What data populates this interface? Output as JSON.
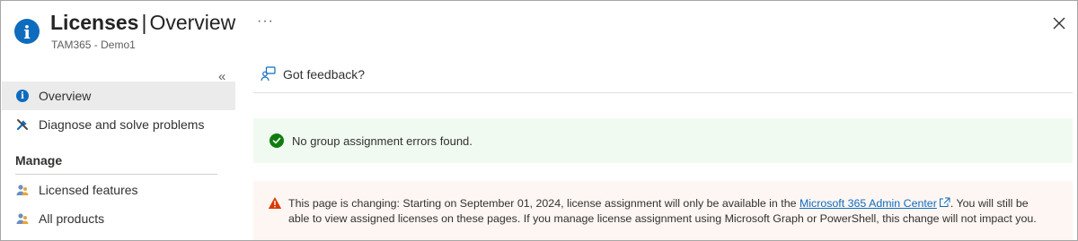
{
  "header": {
    "title_bold": "Licenses",
    "separator": "|",
    "title_light": "Overview",
    "subtitle": "TAM365 - Demo1",
    "more_label": "···",
    "icons": {
      "page": "info-icon",
      "close": "close-icon"
    }
  },
  "sidebar": {
    "collapse_label": "«",
    "items": [
      {
        "label": "Overview",
        "icon": "info-icon",
        "active": true
      },
      {
        "label": "Diagnose and solve problems",
        "icon": "wrench-screwdriver-icon",
        "active": false
      }
    ],
    "group_label": "Manage",
    "manage_items": [
      {
        "label": "Licensed features",
        "icon": "users-icon"
      },
      {
        "label": "All products",
        "icon": "users-icon"
      }
    ]
  },
  "toolbar": {
    "feedback_label": "Got feedback?",
    "feedback_icon": "feedback-person-icon"
  },
  "success": {
    "message": "No group assignment errors found.",
    "icon": "check-circle-icon",
    "color": "#107c10"
  },
  "warning": {
    "text_before": "This page is changing: Starting on September 01, 2024, license assignment will only be available in the ",
    "link_text": "Microsoft 365 Admin Center",
    "text_after": ". You will still be able to view assigned licenses on these pages. If you manage license assignment using Microsoft Graph or PowerShell, this change will not impact you.",
    "icon": "warning-triangle-icon",
    "link_icon": "external-link-icon",
    "color": "#d83b01"
  },
  "colors": {
    "accent": "#0f6cbd",
    "success_bg": "#f1faf1",
    "warning_bg": "#fdf6f3",
    "nav_active_bg": "#ebebeb"
  }
}
